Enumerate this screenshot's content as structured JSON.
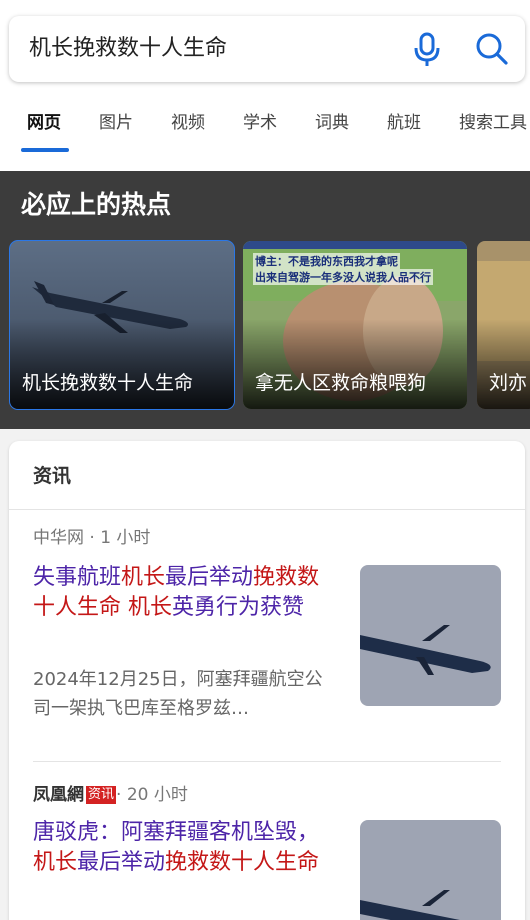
{
  "search": {
    "query": "机长挽救数十人生命"
  },
  "tabs": [
    {
      "label": "网页",
      "active": true
    },
    {
      "label": "图片"
    },
    {
      "label": "视频"
    },
    {
      "label": "学术"
    },
    {
      "label": "词典"
    },
    {
      "label": "航班"
    },
    {
      "label": "搜索工具"
    }
  ],
  "hot": {
    "title": "必应上的热点",
    "cards": [
      {
        "label": "机长挽救数十人生命"
      },
      {
        "label": "拿无人区救命粮喂狗",
        "overlay_line1": "博主：不是我的东西我才拿呢",
        "overlay_line2": "出来自驾游一年多没人说我人品不行"
      },
      {
        "label": "刘亦"
      }
    ]
  },
  "news": {
    "header": "资讯",
    "items": [
      {
        "source": "中华网 · 1 小时",
        "headline": [
          {
            "text": "失事航班",
            "hl": false
          },
          {
            "text": "机长",
            "hl": true
          },
          {
            "text": "最后举动",
            "hl": false
          },
          {
            "text": "挽救",
            "hl": true
          },
          {
            "text": "数十人生命",
            "hl": true
          },
          {
            "text": " ",
            "hl": false
          },
          {
            "text": "机长",
            "hl": true
          },
          {
            "text": "英勇行为获赞",
            "hl": false
          }
        ],
        "snippet": "2024年12月25日，阿塞拜疆航空公司一架执飞巴库至格罗兹…"
      },
      {
        "source_logo": "凤凰網",
        "source_badge": "资讯",
        "source_time": "· 20 小时",
        "headline": [
          {
            "text": "唐驳虎：阿塞拜疆客机坠毁，",
            "hl": false
          },
          {
            "text": "机长",
            "hl": true
          },
          {
            "text": "最后举动",
            "hl": false
          },
          {
            "text": "挽救数十人生命",
            "hl": true
          }
        ]
      }
    ]
  },
  "colors": {
    "accent": "#1a6ad8",
    "headline": "#4d25a8",
    "highlight": "#c41717",
    "hot_bg": "#3c3c3c"
  }
}
